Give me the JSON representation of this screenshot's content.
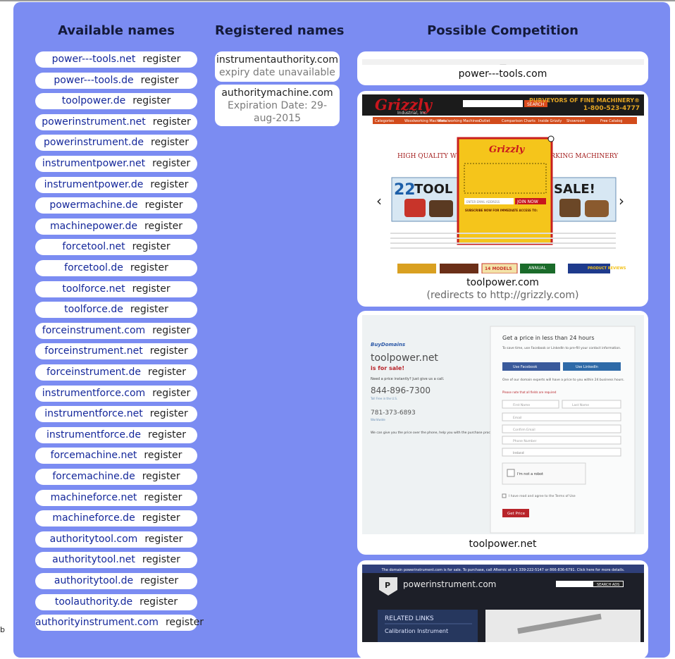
{
  "headers": {
    "available": "Available names",
    "registered": "Registered names",
    "competition": "Possible Competition"
  },
  "register_label": "register",
  "available": [
    "power---tools.net",
    "power---tools.de",
    "toolpower.de",
    "powerinstrument.net",
    "powerinstrument.de",
    "instrumentpower.net",
    "instrumentpower.de",
    "powermachine.de",
    "machinepower.de",
    "forcetool.net",
    "forcetool.de",
    "toolforce.net",
    "toolforce.de",
    "forceinstrument.com",
    "forceinstrument.net",
    "forceinstrument.de",
    "instrumentforce.com",
    "instrumentforce.net",
    "instrumentforce.de",
    "forcemachine.net",
    "forcemachine.de",
    "machineforce.net",
    "machineforce.de",
    "authoritytool.com",
    "authoritytool.net",
    "authoritytool.de",
    "toolauthority.de",
    "authorityinstrument.com"
  ],
  "registered": [
    {
      "name": "instrumentauthority.com",
      "note": "expiry date unavailable"
    },
    {
      "name": "authoritymachine.com",
      "note": "Expiration Date: 29-aug-2015"
    }
  ],
  "competition": [
    {
      "domain": "power---tools.com"
    },
    {
      "domain": "toolpower.com",
      "redirect": "(redirects to http://grizzly.com)",
      "shot": {
        "logo": "Grizzly",
        "logo_sub": "Industrial, Inc.",
        "tagline": "PURVEYORS OF FINE MACHINERY®",
        "phone": "1-800-523-4777",
        "search": "SEARCH",
        "nav": [
          "Categories",
          "Woodworking Machines",
          "Metalworking Machines",
          "Outlet",
          "Comparison Charts",
          "Inside Grizzly",
          "Showroom",
          "Free Catalog"
        ],
        "headline_l": "HIGH QUALITY WOOD",
        "headline_r": "ORKING MACHINERY",
        "banner_num": "22",
        "banner_l": "TOOL O",
        "banner_r": "SALE!",
        "popup_email": "ENTER EMAIL ADDRESS",
        "popup_join": "JOIN NOW",
        "popup_sub": "SUBSCRIBE NOW FOR IMMEDIATE ACCESS TO:",
        "badge1": "14 MODELS",
        "badge2": "ANNUAL",
        "badge3": "PRODUCT REVIEWS"
      }
    },
    {
      "domain": "toolpower.net",
      "shot": {
        "brand": "BuyDomains",
        "name": "toolpower.net",
        "for_sale": "is for sale!",
        "instant": "Need a price instantly? Just give us a call.",
        "phone1": "844-896-7300",
        "phone1_note": "Toll Free in the U.S.",
        "phone2": "781-373-6893",
        "phone2_note": "Worldwide",
        "blurb": "We can give you the price over the phone, help you with the purchase process, and answer any questions.",
        "form_title": "Get a price in less than 24 hours",
        "form_sub": "To save time, use Facebook or LinkedIn to pre-fill your contact information.",
        "fb": "Use Facebook",
        "li": "Use LinkedIn",
        "experts": "One of our domain experts will have a price to you within 24 business hours.",
        "required": "Please note that all fields are required",
        "first": "First Name",
        "last": "Last Name",
        "email": "Email",
        "confirm": "Confirm Email",
        "phonefield": "Phone Number",
        "country": "Ireland",
        "robot": "I'm not a robot",
        "terms": "I have read and agree to the Terms of Use",
        "get_price": "Get Price"
      }
    },
    {
      "domain": "powerinstrument.com",
      "shot": {
        "topbar": "The domain powerinstrument.com is for sale. To purchase, call Afternic at +1 339-222-5147 or 866-836-6791. Click here for more details.",
        "site": "powerinstrument.com",
        "search": "SEARCH ADS",
        "related": "RELATED LINKS",
        "link1": "Calibration Instrument"
      }
    }
  ],
  "left_tab": "b"
}
